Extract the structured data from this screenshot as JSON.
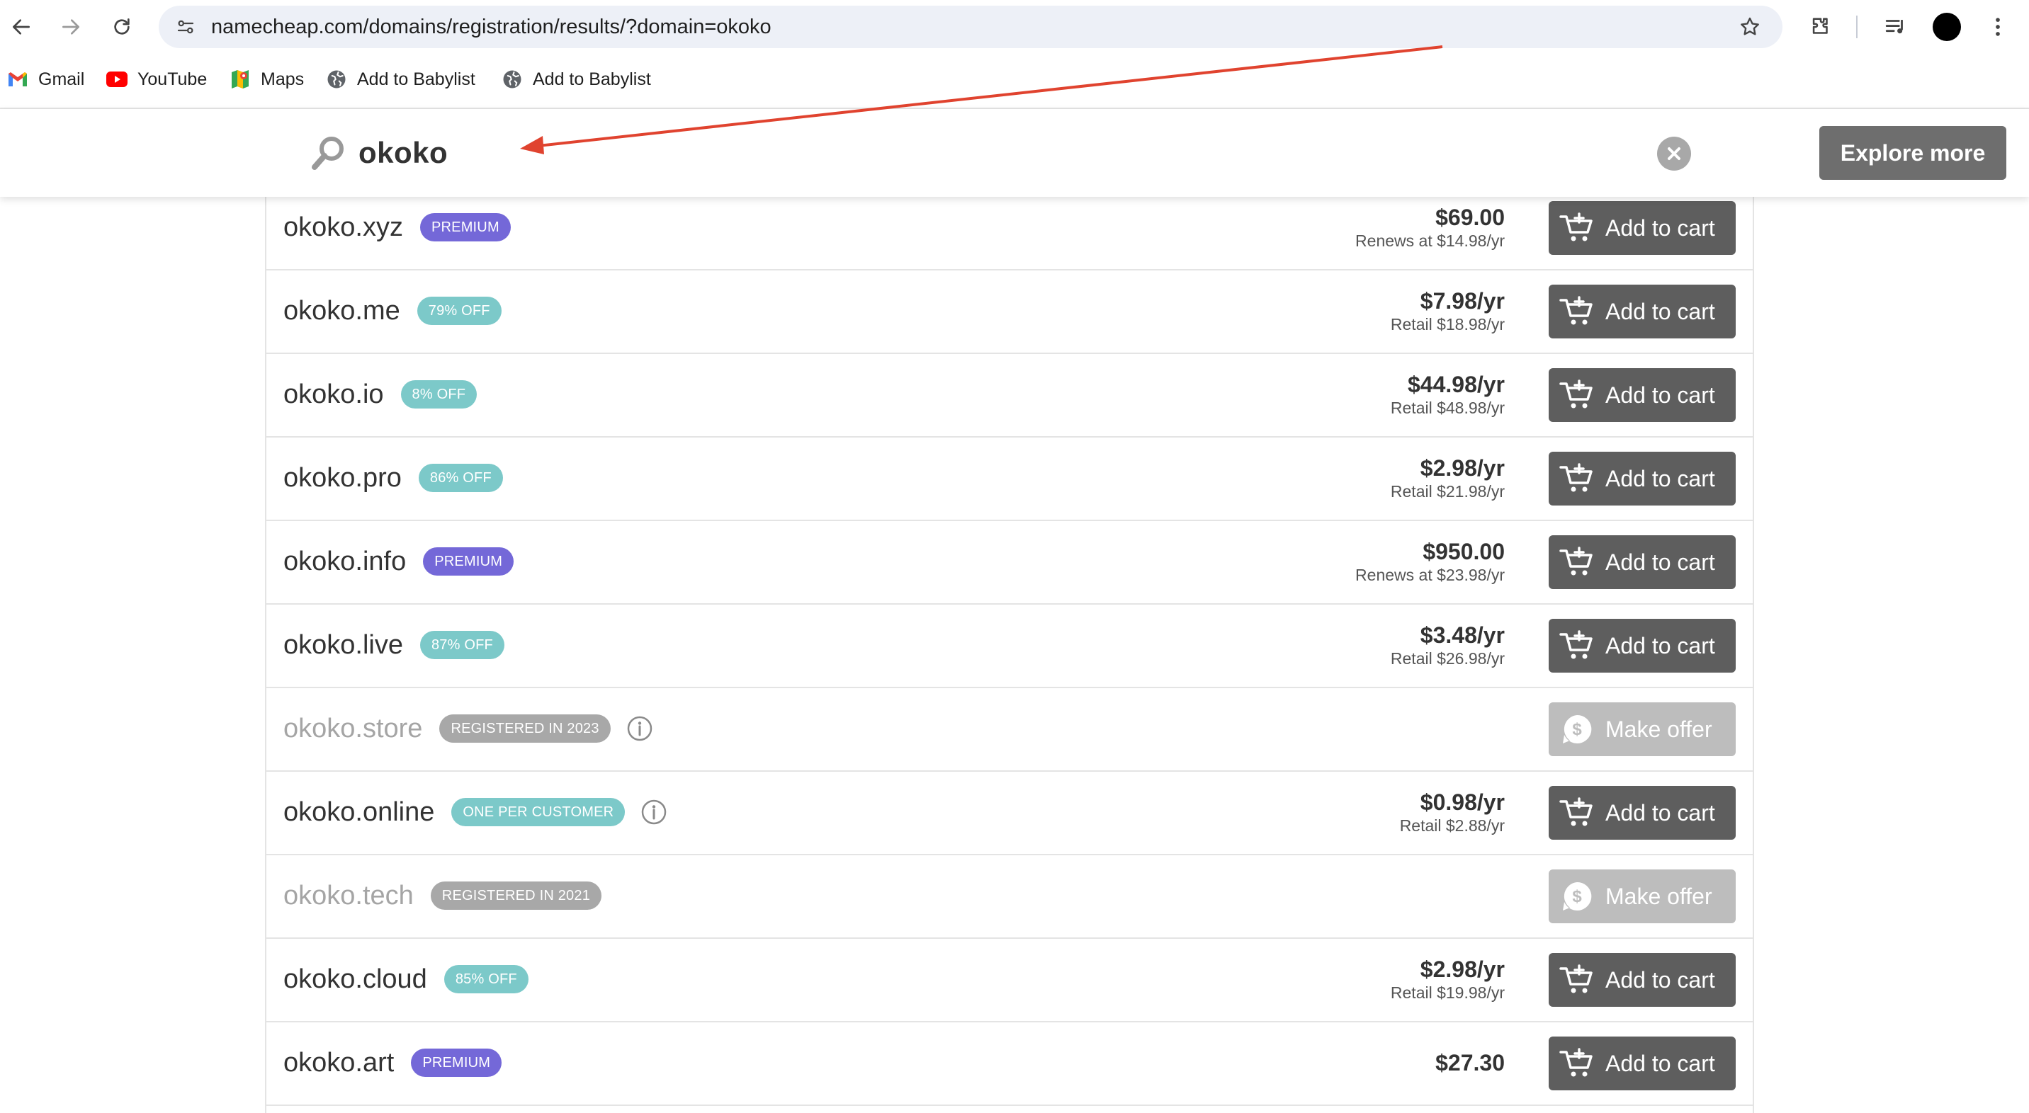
{
  "browser": {
    "url": "namecheap.com/domains/registration/results/?domain=okoko",
    "bookmarks": [
      {
        "label": "Gmail",
        "icon": "gmail-icon"
      },
      {
        "label": "YouTube",
        "icon": "youtube-icon"
      },
      {
        "label": "Maps",
        "icon": "maps-icon"
      },
      {
        "label": "Add to Babylist",
        "icon": "globe-icon"
      },
      {
        "label": "Add to Babylist",
        "icon": "globe-icon"
      }
    ]
  },
  "search": {
    "query": "okoko",
    "explore_label": "Explore more"
  },
  "colors": {
    "premium_badge": "#7468d8",
    "discount_badge": "#7cc9c9",
    "registered_badge": "#a8a8a8",
    "cart_button": "#5e5e5e",
    "offer_button": "#bdbdbd",
    "annotation_arrow": "#e0432f"
  },
  "results": [
    {
      "domain": "okoko.xyz",
      "badge": "PREMIUM",
      "badge_type": "premium",
      "price": "$69.00",
      "sub": "Renews at $14.98/yr",
      "action": "Add to cart",
      "action_type": "cart"
    },
    {
      "domain": "okoko.me",
      "badge": "79% OFF",
      "badge_type": "off",
      "price": "$7.98/yr",
      "sub": "Retail $18.98/yr",
      "action": "Add to cart",
      "action_type": "cart"
    },
    {
      "domain": "okoko.io",
      "badge": "8% OFF",
      "badge_type": "off",
      "price": "$44.98/yr",
      "sub": "Retail $48.98/yr",
      "action": "Add to cart",
      "action_type": "cart"
    },
    {
      "domain": "okoko.pro",
      "badge": "86% OFF",
      "badge_type": "off",
      "price": "$2.98/yr",
      "sub": "Retail $21.98/yr",
      "action": "Add to cart",
      "action_type": "cart"
    },
    {
      "domain": "okoko.info",
      "badge": "PREMIUM",
      "badge_type": "premium",
      "price": "$950.00",
      "sub": "Renews at $23.98/yr",
      "action": "Add to cart",
      "action_type": "cart"
    },
    {
      "domain": "okoko.live",
      "badge": "87% OFF",
      "badge_type": "off",
      "price": "$3.48/yr",
      "sub": "Retail $26.98/yr",
      "action": "Add to cart",
      "action_type": "cart"
    },
    {
      "domain": "okoko.store",
      "badge": "REGISTERED IN 2023",
      "badge_type": "reg",
      "info": true,
      "price": "",
      "sub": "",
      "action": "Make offer",
      "action_type": "offer"
    },
    {
      "domain": "okoko.online",
      "badge": "ONE PER CUSTOMER",
      "badge_type": "off",
      "info": true,
      "price": "$0.98/yr",
      "sub": "Retail $2.88/yr",
      "action": "Add to cart",
      "action_type": "cart"
    },
    {
      "domain": "okoko.tech",
      "badge": "REGISTERED IN 2021",
      "badge_type": "reg",
      "price": "",
      "sub": "",
      "action": "Make offer",
      "action_type": "offer"
    },
    {
      "domain": "okoko.cloud",
      "badge": "85% OFF",
      "badge_type": "off",
      "price": "$2.98/yr",
      "sub": "Retail $19.98/yr",
      "action": "Add to cart",
      "action_type": "cart"
    },
    {
      "domain": "okoko.art",
      "badge": "PREMIUM",
      "badge_type": "premium",
      "price": "$27.30",
      "sub": "",
      "action": "Add to cart",
      "action_type": "cart"
    }
  ]
}
